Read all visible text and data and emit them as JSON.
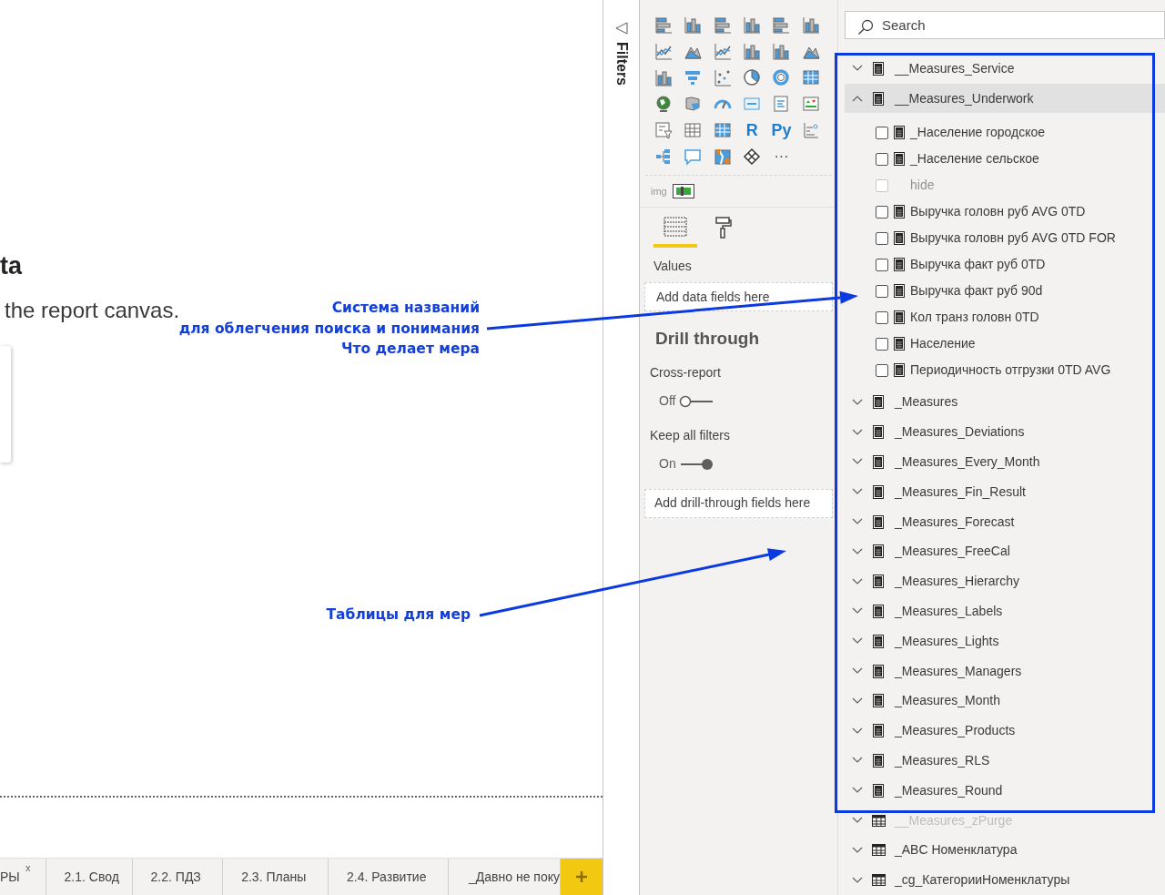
{
  "canvas": {
    "title": "ta",
    "subtitle": "the report canvas."
  },
  "filters_pane": {
    "title": "Filters"
  },
  "visualizations": {
    "script_labels": [
      "R",
      "Py"
    ],
    "more": "···",
    "custom_visual": "img",
    "tabs": [
      {
        "kind": "fields",
        "selected": true
      },
      {
        "kind": "format",
        "selected": false
      }
    ],
    "values_label": "Values",
    "values_placeholder": "Add data fields here",
    "drill_through": {
      "title": "Drill through",
      "cross_report": {
        "label": "Cross-report",
        "state": "Off",
        "on": false
      },
      "keep_all_filters": {
        "label": "Keep all filters",
        "state": "On",
        "on": true
      },
      "placeholder": "Add drill-through fields here"
    }
  },
  "fields": {
    "search": {
      "placeholder": "Search"
    },
    "tables": [
      {
        "name": "__Measures_Service",
        "kind": "measure_table",
        "expanded": false,
        "selected": false,
        "hidden": false
      },
      {
        "name": "__Measures_Underwork",
        "kind": "measure_table",
        "expanded": true,
        "selected": true,
        "hidden": false,
        "children": [
          {
            "name": "_Население городское",
            "kind": "measure",
            "checked": false,
            "hidden": false
          },
          {
            "name": "_Население сельское",
            "kind": "measure",
            "checked": false,
            "hidden": false
          },
          {
            "name": "hide",
            "kind": "field",
            "checked": false,
            "hidden": true
          },
          {
            "name": "Выручка головн руб AVG 0TD",
            "kind": "measure",
            "checked": false,
            "hidden": false
          },
          {
            "name": "Выручка головн руб AVG 0TD FOR",
            "kind": "measure",
            "checked": false,
            "hidden": false
          },
          {
            "name": "Выручка факт руб 0TD",
            "kind": "measure",
            "checked": false,
            "hidden": false
          },
          {
            "name": "Выручка факт руб 90d",
            "kind": "measure",
            "checked": false,
            "hidden": false
          },
          {
            "name": "Кол транз головн 0TD",
            "kind": "measure",
            "checked": false,
            "hidden": false
          },
          {
            "name": "Население",
            "kind": "measure",
            "checked": false,
            "hidden": false
          },
          {
            "name": "Периодичность отгрузки 0TD AVG",
            "kind": "measure",
            "checked": false,
            "hidden": false
          }
        ]
      },
      {
        "name": "_Measures",
        "kind": "measure_table",
        "expanded": false,
        "selected": false,
        "hidden": false
      },
      {
        "name": "_Measures_Deviations",
        "kind": "measure_table",
        "expanded": false,
        "selected": false,
        "hidden": false
      },
      {
        "name": "_Measures_Every_Month",
        "kind": "measure_table",
        "expanded": false,
        "selected": false,
        "hidden": false
      },
      {
        "name": "_Measures_Fin_Result",
        "kind": "measure_table",
        "expanded": false,
        "selected": false,
        "hidden": false
      },
      {
        "name": "_Measures_Forecast",
        "kind": "measure_table",
        "expanded": false,
        "selected": false,
        "hidden": false
      },
      {
        "name": "_Measures_FreeCal",
        "kind": "measure_table",
        "expanded": false,
        "selected": false,
        "hidden": false
      },
      {
        "name": "_Measures_Hierarchy",
        "kind": "measure_table",
        "expanded": false,
        "selected": false,
        "hidden": false
      },
      {
        "name": "_Measures_Labels",
        "kind": "measure_table",
        "expanded": false,
        "selected": false,
        "hidden": false
      },
      {
        "name": "_Measures_Lights",
        "kind": "measure_table",
        "expanded": false,
        "selected": false,
        "hidden": false
      },
      {
        "name": "_Measures_Managers",
        "kind": "measure_table",
        "expanded": false,
        "selected": false,
        "hidden": false
      },
      {
        "name": "_Measures_Month",
        "kind": "measure_table",
        "expanded": false,
        "selected": false,
        "hidden": false
      },
      {
        "name": "_Measures_Products",
        "kind": "measure_table",
        "expanded": false,
        "selected": false,
        "hidden": false
      },
      {
        "name": "_Measures_RLS",
        "kind": "measure_table",
        "expanded": false,
        "selected": false,
        "hidden": false
      },
      {
        "name": "_Measures_Round",
        "kind": "measure_table",
        "expanded": false,
        "selected": false,
        "hidden": false
      },
      {
        "name": "__Measures_zPurge",
        "kind": "table",
        "expanded": false,
        "selected": false,
        "hidden": true
      },
      {
        "name": "_ABC Номенклатура",
        "kind": "table",
        "expanded": false,
        "selected": false,
        "hidden": false
      },
      {
        "name": "_cg_КатегорииНоменклатуры",
        "kind": "table",
        "expanded": false,
        "selected": false,
        "hidden": false
      }
    ]
  },
  "page_tabs": [
    {
      "label": "РЫ",
      "close": "x"
    },
    {
      "label": "2.1. Свод"
    },
    {
      "label": "2.2. ПДЗ"
    },
    {
      "label": "2.3. Планы"
    },
    {
      "label": "2.4. Развитие"
    },
    {
      "label": "_Давно не поку"
    }
  ],
  "annotations": [
    {
      "lines": [
        "Система названий",
        "для облегчения поиска и понимания",
        "Что делает мера"
      ]
    },
    {
      "lines": [
        "Таблицы для мер"
      ]
    }
  ]
}
